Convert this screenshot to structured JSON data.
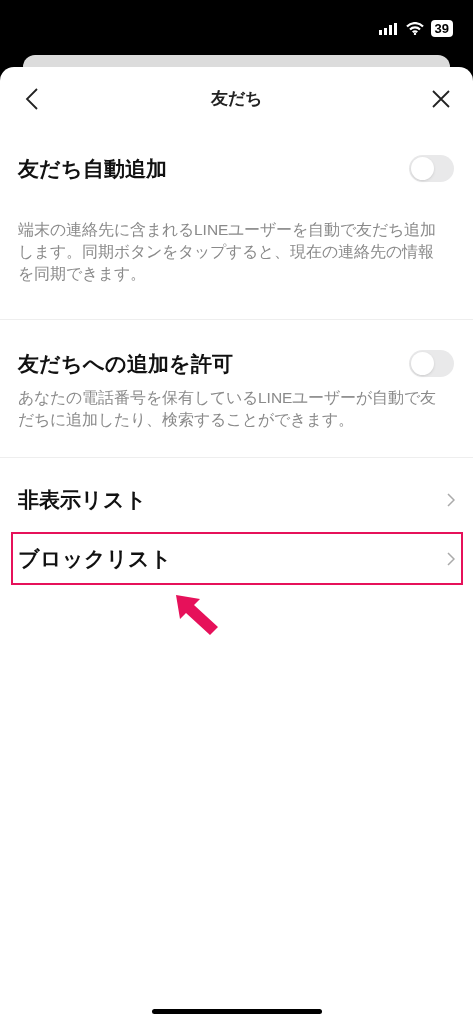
{
  "status_bar": {
    "battery": "39"
  },
  "header": {
    "title": "友だち"
  },
  "toggles": [
    {
      "label": "友だち自動追加",
      "on": false,
      "description": "端末の連絡先に含まれるLINEユーザーを自動で友だち追加します。同期ボタンをタップすると、現在の連絡先の情報を同期できます。"
    },
    {
      "label": "友だちへの追加を許可",
      "on": false,
      "description": "あなたの電話番号を保有しているLINEユーザーが自動で友だちに追加したり、検索することができます。"
    }
  ],
  "links": [
    {
      "label": "非表示リスト",
      "highlighted": false
    },
    {
      "label": "ブロックリスト",
      "highlighted": true
    }
  ]
}
